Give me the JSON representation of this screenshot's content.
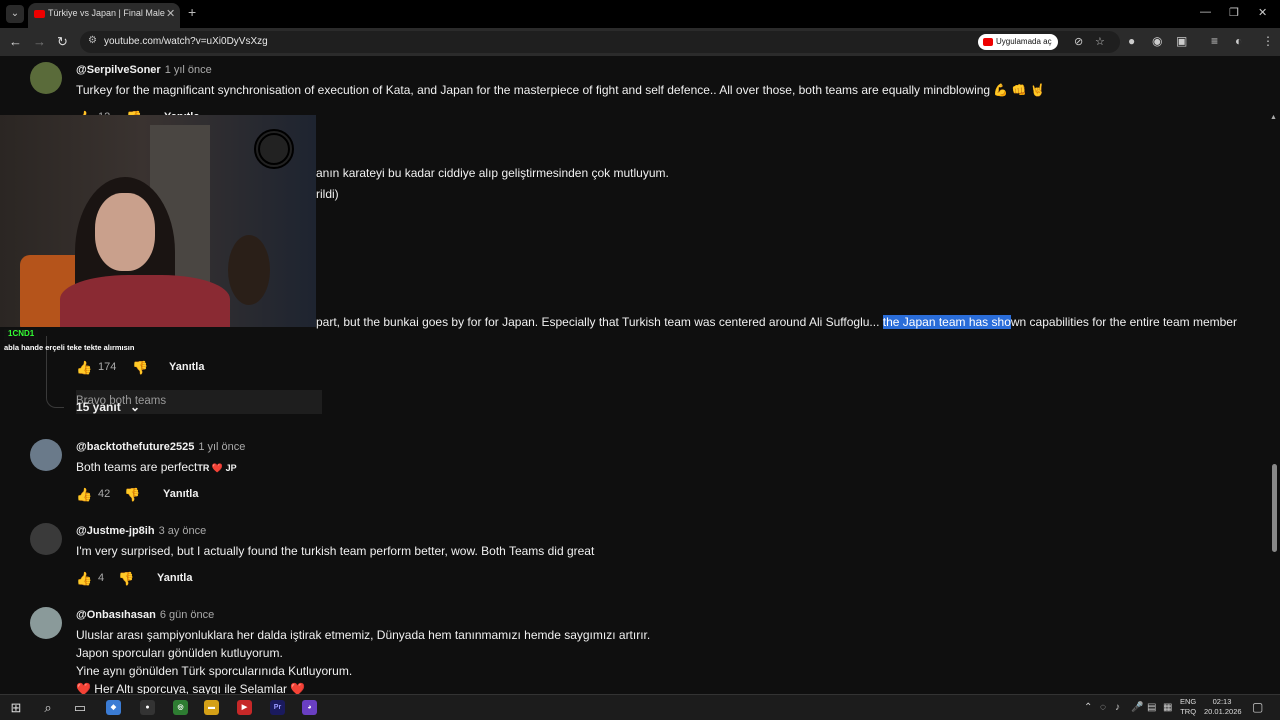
{
  "browser": {
    "tab_title": "Türkiye vs Japan | Final Male Ka",
    "tab_close": "✕",
    "new_tab": "+",
    "url": "youtube.com/watch?v=uXi0DyVsXzg",
    "open_in_app": "Uygulamada aç",
    "window": {
      "minimize": "—",
      "restore": "❐",
      "close": "✕"
    }
  },
  "comments": [
    {
      "handle": "@SerpilveSoner",
      "time": "1 yıl önce",
      "text": "Turkey for the magnificant synchronisation of execution of Kata, and Japan for the masterpiece of fight and self defence.. All over those, both teams are equally mindblowing 💪 👊 🤘",
      "likes": "12",
      "reply": "Yanıtla"
    },
    {
      "partial_text_1": "anın karateyi bu kadar ciddiye alıp geliştirmesinden çok mutluyum.",
      "partial_text_2": "rildi)"
    },
    {
      "text_before": "part, but the bunkai goes by for for Japan. Especially that Turkish team was centered around Ali Suffoglu... ",
      "text_highlight": "the Japan team has sho",
      "text_after": "wn capabilities for the entire team member",
      "likes": "174",
      "reply": "Yanıtla",
      "replies_toggle": "15 yanıt"
    },
    {
      "handle": "@backtothefuture2525",
      "time": "1 yıl önce",
      "text": "Both teams are perfect",
      "flags": "TR ❤️ JP",
      "likes": "42",
      "reply": "Yanıtla"
    },
    {
      "handle": "@Justme-jp8ih",
      "time": "3 ay önce",
      "text": "I'm very surprised, but I actually found the turkish team perform better, wow. Both Teams did great",
      "likes": "4",
      "reply": "Yanıtla"
    },
    {
      "handle": "@Onbasıhasan",
      "time": "6 gün önce",
      "lines": [
        "Uluslar arası şampiyonluklara her dalda iştirak etmemiz, Dünyada hem tanınmamızı hemde saygımızı artırır.",
        "Japon sporcuları gönülden kutluyorum.",
        "Yine aynı gönülden Türk sporcularınıda Kutluyorum.",
        "❤️ Her Altı sporcuya, saygı ile Selamlar ❤️"
      ]
    }
  ],
  "overlay": {
    "chat_badge": "1CND1",
    "chat_line": "abla hande erçeli teke tekte alırmısın",
    "faded_text": "Bravo both teams"
  },
  "taskbar": {
    "lang_top": "ENG",
    "lang_bottom": "TRQ",
    "time": "02:13",
    "date": "20.01.2026"
  },
  "colors": {
    "background": "#0f0f0f",
    "highlight": "#2a6dd9",
    "text": "#f1f1f1",
    "muted": "#aaaaaa"
  }
}
